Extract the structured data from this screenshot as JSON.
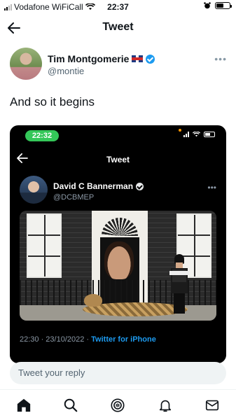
{
  "status_bar": {
    "carrier": "Vodafone WiFiCall",
    "time": "22:37"
  },
  "header": {
    "title": "Tweet"
  },
  "tweet": {
    "author_name": "Tim Montgomerie",
    "author_handle": "@montie",
    "text": "And so it begins"
  },
  "embedded": {
    "time_pill": "22:32",
    "title": "Tweet",
    "author_name": "David C Bannerman",
    "author_handle": "@DCBMEP",
    "timestamp": "22:30 · 23/10/2022 · ",
    "source": "Twitter for iPhone"
  },
  "reply": {
    "placeholder": "Tweet your reply"
  },
  "nav": [
    "home-icon",
    "search-icon",
    "spaces-icon",
    "notifications-icon",
    "messages-icon"
  ],
  "colors": {
    "accent": "#1d9bf0",
    "text": "#0f1419",
    "secondary": "#536471"
  }
}
